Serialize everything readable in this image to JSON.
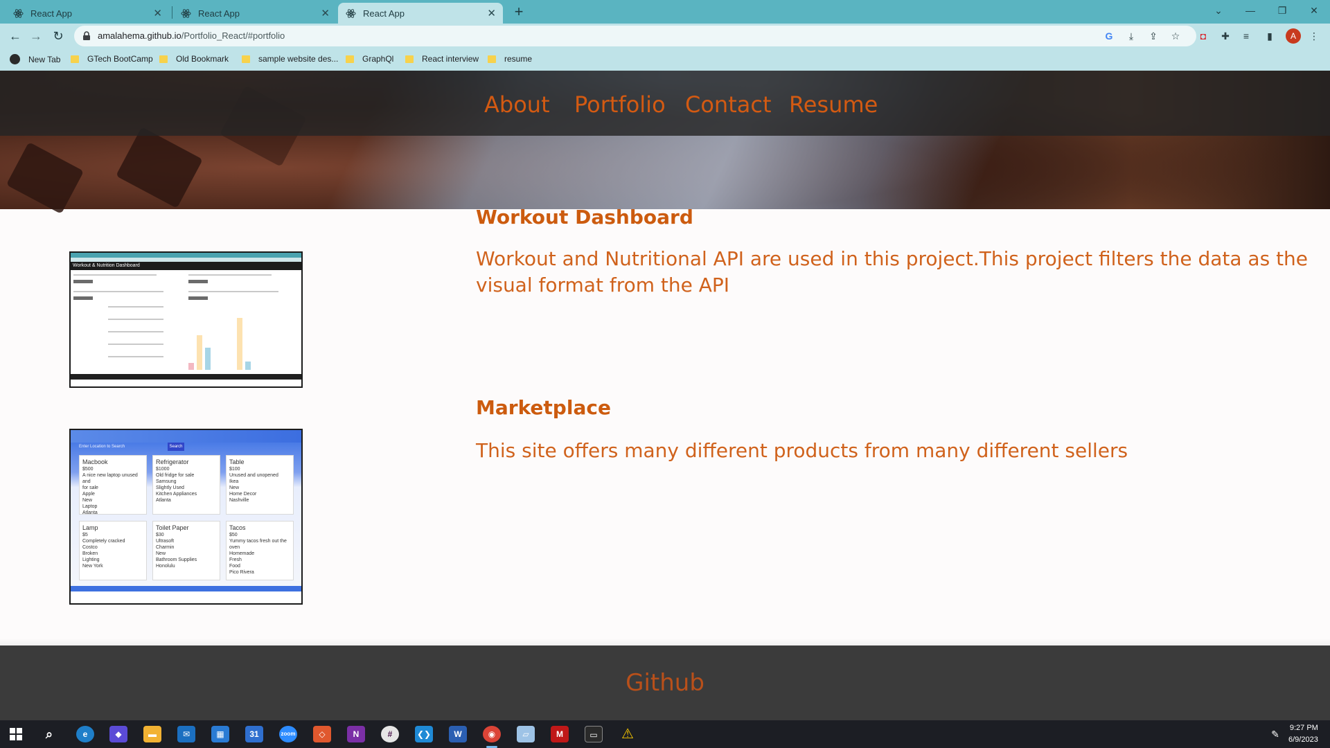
{
  "browser": {
    "tabs": [
      {
        "title": "React App"
      },
      {
        "title": "React App"
      },
      {
        "title": "React App",
        "active": true
      }
    ],
    "url_host": "amalahema.github.io",
    "url_path": "/Portfolio_React/#portfolio",
    "avatar_letter": "A",
    "bookmarks": [
      "New Tab",
      "GTech BootCamp",
      "Old Bookmark",
      "sample website des...",
      "GraphQl",
      "React interview",
      "resume"
    ]
  },
  "nav": {
    "links": [
      "About",
      "Portfolio",
      "Contact",
      "Resume"
    ],
    "link_color": "#d35a12"
  },
  "projects": [
    {
      "title": "Workout Dashboard",
      "description": "Workout and Nutritional API are used in this project.This project filters the data as the visual format from the API",
      "screenshot_heading": "Workout & Nutrition Dashboard"
    },
    {
      "title": "Marketplace",
      "description": "This site offers many different products from many different sellers",
      "screenshot_cards": [
        {
          "name": "Macbook",
          "lines": [
            "$500",
            "A nice new laptop unused and",
            "for sale",
            "Apple",
            "New",
            "Laptop",
            "Atlanta"
          ]
        },
        {
          "name": "Refrigerator",
          "lines": [
            "$1000",
            "Old fridge for sale",
            "Samsung",
            "Slightly Used",
            "Kitchen Appliances",
            "Atlanta"
          ]
        },
        {
          "name": "Table",
          "lines": [
            "$100",
            "Unused and unopened",
            "Ikea",
            "New",
            "Home Decor",
            "Nashville"
          ]
        },
        {
          "name": "Lamp",
          "lines": [
            "$5",
            "Completely cracked",
            "Costco",
            "Broken",
            "Lighting",
            "New York"
          ]
        },
        {
          "name": "Toilet Paper",
          "lines": [
            "$30",
            "Ultrasoft",
            "Charmin",
            "New",
            "Bathroom Supplies",
            "Honolulu"
          ]
        },
        {
          "name": "Tacos",
          "lines": [
            "$50",
            "Yummy tacos fresh out the oven",
            "Homemade",
            "Fresh",
            "Food",
            "Pico Rivera"
          ]
        }
      ],
      "screenshot_search_placeholder": "Enter Location to Search",
      "screenshot_search_button": "Search"
    }
  ],
  "footer": {
    "link": "Github",
    "link_color": "#b9501a"
  },
  "taskbar": {
    "time": "9:27 PM",
    "date": "6/9/2023"
  }
}
